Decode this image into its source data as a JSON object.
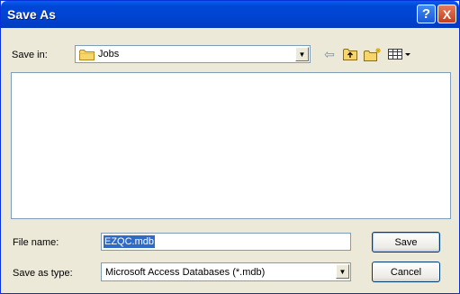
{
  "window": {
    "title": "Save As"
  },
  "title_buttons": {
    "help": "?",
    "close": "X"
  },
  "save_in": {
    "label": "Save in:",
    "value": "Jobs",
    "icon": "folder-icon"
  },
  "toolbar": {
    "back_icon": "back-arrow-icon",
    "up_icon": "up-folder-icon",
    "new_folder_icon": "new-folder-icon",
    "views_icon": "views-menu-icon"
  },
  "file_list": {
    "items": []
  },
  "file_name": {
    "label": "File name:",
    "value": "EZQC.mdb"
  },
  "save_as_type": {
    "label": "Save as type:",
    "value": "Microsoft Access Databases (*.mdb)"
  },
  "buttons": {
    "save": "Save",
    "cancel": "Cancel"
  },
  "colors": {
    "titlebar": "#0046d5",
    "selection": "#316ac5",
    "background": "#ece9d8"
  }
}
